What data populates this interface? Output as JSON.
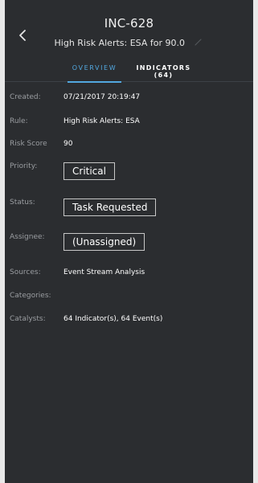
{
  "header": {
    "incident_id": "INC-628",
    "subtitle": "High Risk Alerts: ESA for 90.0"
  },
  "tabs": [
    {
      "label": "OVERVIEW",
      "active": true
    },
    {
      "label": "INDICATORS (64)",
      "active": false
    }
  ],
  "details": {
    "created": {
      "label": "Created:",
      "value": "07/21/2017 20:19:47"
    },
    "rule": {
      "label": "Rule:",
      "value": "High Risk Alerts: ESA"
    },
    "risk_score": {
      "label": "Risk Score",
      "value": "90"
    },
    "priority": {
      "label": "Priority:",
      "value": "Critical"
    },
    "status": {
      "label": "Status:",
      "value": "Task Requested"
    },
    "assignee": {
      "label": "Assignee:",
      "value": "(Unassigned)"
    },
    "sources": {
      "label": "Sources:",
      "value": "Event Stream Analysis"
    },
    "categories": {
      "label": "Categories:",
      "value": ""
    },
    "catalysts": {
      "label": "Catalysts:",
      "value": "64 Indicator(s), 64 Event(s)"
    }
  },
  "colors": {
    "panel_bg": "#2b2d30",
    "page_bg": "#e8e8e8",
    "accent": "#52a8e0",
    "label": "#9a9da1",
    "text": "#ffffff"
  },
  "icons": {
    "back": "chevron-left-icon",
    "edit": "pencil-icon"
  }
}
